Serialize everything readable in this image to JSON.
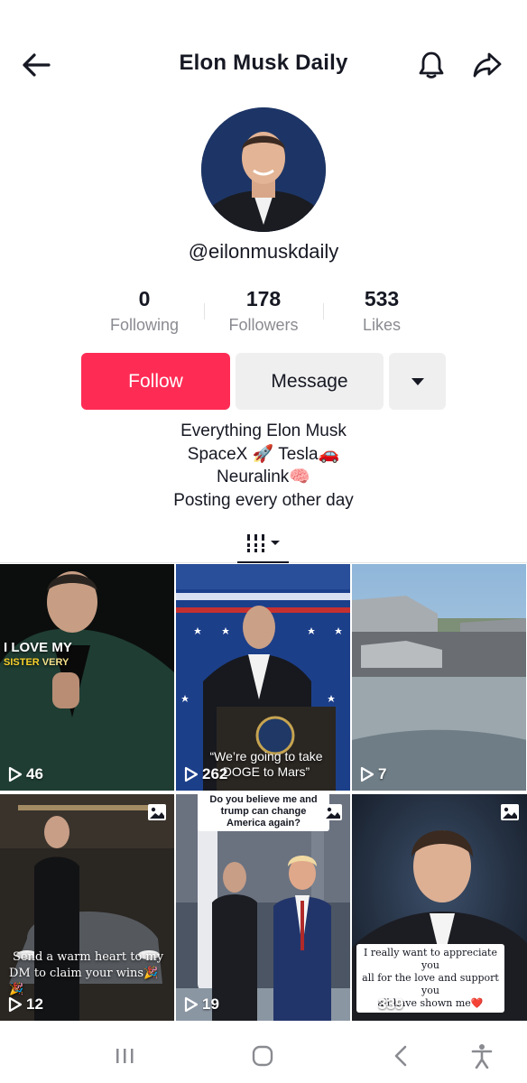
{
  "header": {
    "title": "Elon Musk Daily",
    "back_icon": "arrow-left-icon",
    "bell_icon": "bell-icon",
    "share_icon": "share-arrow-icon"
  },
  "profile": {
    "handle": "@eilonmuskdaily",
    "stats": [
      {
        "value": "0",
        "label": "Following"
      },
      {
        "value": "178",
        "label": "Followers"
      },
      {
        "value": "533",
        "label": "Likes"
      }
    ],
    "follow_label": "Follow",
    "message_label": "Message",
    "bio": [
      "Everything Elon Musk",
      "SpaceX 🚀 Tesla🚗",
      "Neuralink🧠",
      "Posting every other day"
    ]
  },
  "colors": {
    "accent": "#fe2c55",
    "secondary_button": "#efefef",
    "muted_text": "#8a8b91"
  },
  "videos": [
    {
      "views": "46",
      "caption": "I LOVE MY\nSISTER VERY",
      "photo": false
    },
    {
      "views": "262",
      "caption": "\"We're going to take\nDOGE to Mars\"",
      "photo": false
    },
    {
      "views": "7",
      "caption": "",
      "photo": false
    },
    {
      "views": "12",
      "caption": "Send a warm heart to my\nDM to claim your wins🎉🎉",
      "photo": true
    },
    {
      "views": "19",
      "caption": "Do you believe me and\ntrump can change\nAmerica again?",
      "photo": true
    },
    {
      "views": "339",
      "caption": "I really want to appreciate you\nall for the love and support you\nall have shown me❤️",
      "photo": true
    }
  ]
}
